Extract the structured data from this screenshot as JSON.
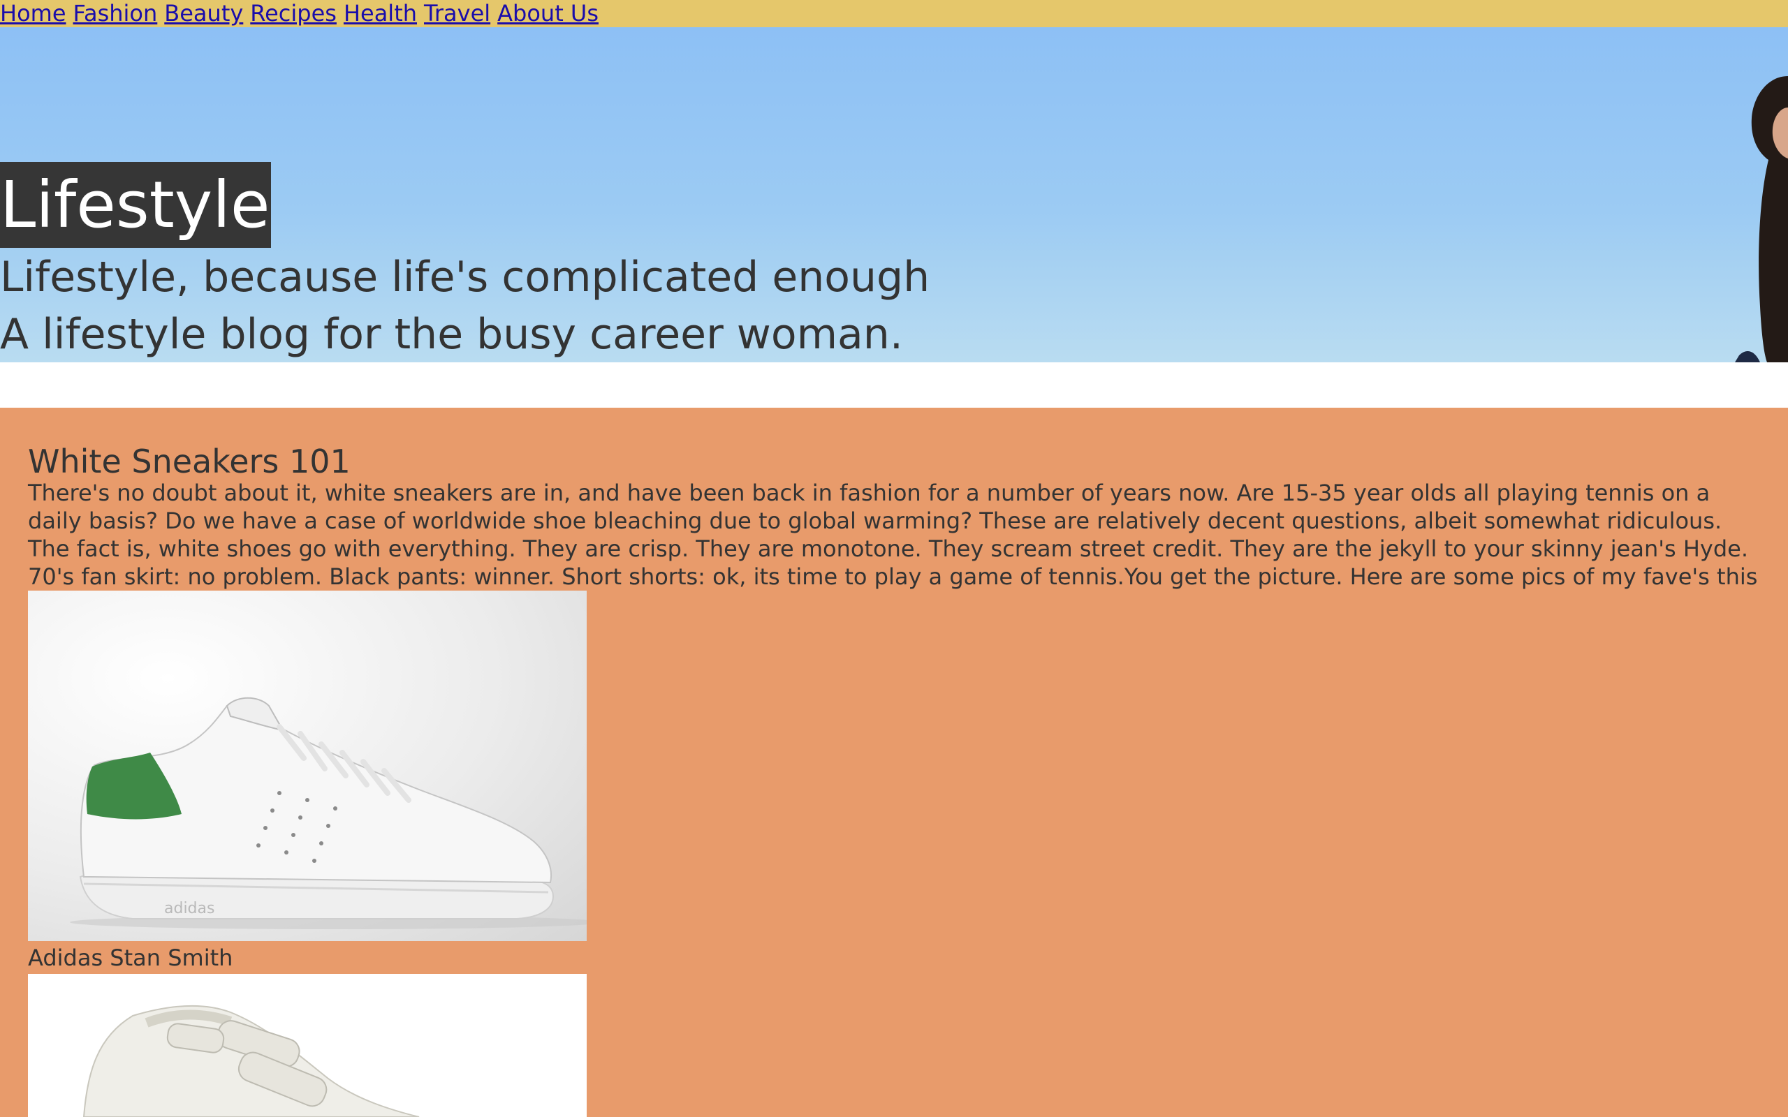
{
  "nav": {
    "items": [
      {
        "label": "Home"
      },
      {
        "label": "Fashion"
      },
      {
        "label": "Beauty"
      },
      {
        "label": "Recipes"
      },
      {
        "label": "Health"
      },
      {
        "label": "Travel"
      },
      {
        "label": "About Us"
      }
    ]
  },
  "hero": {
    "title": "Lifestyle",
    "tagline_1": "Lifestyle, because life's complicated enough",
    "tagline_2": "A lifestyle blog for the busy career woman."
  },
  "article": {
    "title": "White Sneakers 101",
    "body": "There's no doubt about it, white sneakers are in, and have been back in fashion for a number of years now. Are 15-35 year olds all playing tennis on a daily basis? Do we have a case of worldwide shoe bleaching due to global warming? These are relatively decent questions, albeit somewhat ridiculous. The fact is, white shoes go with everything. They are crisp. They are monotone. They scream street credit. They are the jekyll to your skinny jean's Hyde. 70's fan skirt: no problem. Black pants: winner. Short shorts: ok, its time to play a game of tennis.You get the picture. Here are some pics of my fave's this seasons:",
    "products": [
      {
        "caption": "Adidas Stan Smith",
        "shoe_brand_mark": "adidas"
      }
    ]
  },
  "colors": {
    "nav_bg": "#e5c76b",
    "article_bg": "#e89b6b",
    "title_bg": "#363636",
    "sky": "#8dc0f5",
    "link": "#1a0dab",
    "shoe_accent": "#3f8a47"
  }
}
